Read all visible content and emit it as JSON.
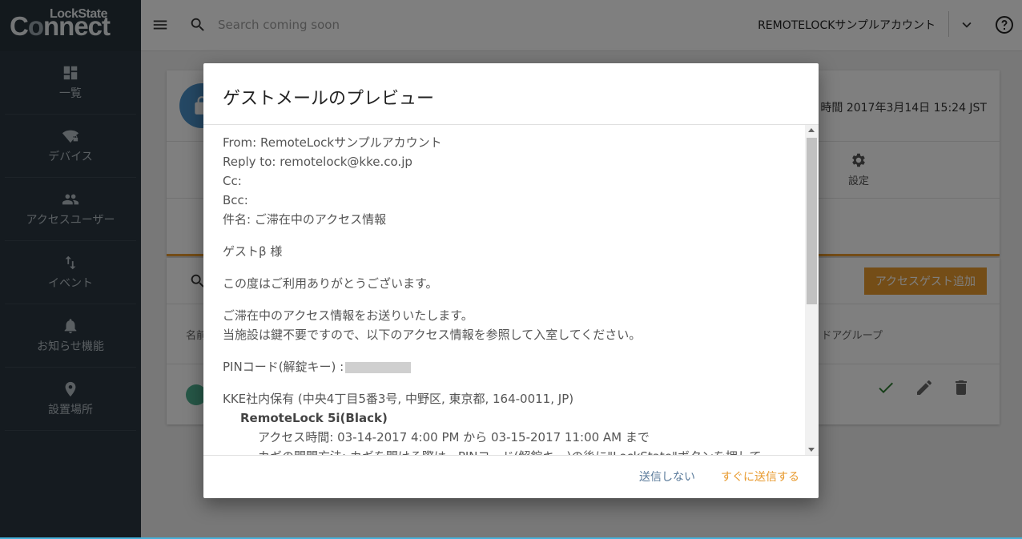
{
  "brand": {
    "top": "LockState",
    "main_c": "C",
    "main_o": "o",
    "main_rest": "nnect"
  },
  "sidebar": {
    "items": [
      {
        "label": "一覧",
        "icon": "dashboard-icon"
      },
      {
        "label": "デバイス",
        "icon": "wifi-lock-icon"
      },
      {
        "label": "アクセスユーザー",
        "icon": "people-icon"
      },
      {
        "label": "イベント",
        "icon": "swap-vert-icon"
      },
      {
        "label": "お知らせ機能",
        "icon": "bell-icon"
      },
      {
        "label": "設置場所",
        "icon": "location-pin-icon"
      }
    ]
  },
  "topbar": {
    "search_placeholder": "Search coming soon",
    "account": "REMOTELOCKサンプルアカウント"
  },
  "background": {
    "time_text": "時間 2017年3月14日 15:24 JST",
    "settings_label": "設定",
    "add_guest_button": "アクセスゲスト追加",
    "col_name": "名前",
    "col_group": "ドアグループ"
  },
  "dialog": {
    "title": "ゲストメールのプレビュー",
    "from": "From: RemoteLockサンプルアカウント",
    "reply_to": "Reply to: remotelock@kke.co.jp",
    "cc": "Cc:",
    "bcc": "Bcc:",
    "subject": "件名: ご滞在中のアクセス情報",
    "greeting": "ゲストβ 様",
    "thanks": "この度はご利用ありがとうございます。",
    "intro1": "ご滞在中のアクセス情報をお送りいたします。",
    "intro2": "当施設は鍵不要ですので、以下のアクセス情報を参照して入室してください。",
    "pin_label": "PINコード(解錠キー) :",
    "location": "KKE社内保有 (中央4丁目5番3号, 中野区, 東京都, 164-0011, JP)",
    "lock_name": "RemoteLock 5i(Black)",
    "access_time": "アクセス時間: 03-14-2017 4:00 PM から 03-15-2017 11:00 AM まで",
    "how_to_open": "カギの開閉方法: カギを開ける際は、PINコード(解錠キー)の後に\"LockState\"ボタンを押して",
    "cancel_button": "送信しない",
    "send_button": "すぐに送信する"
  },
  "colors": {
    "accent": "#e89a2e",
    "sidebar": "#2a3640",
    "link": "#5a7a9a"
  }
}
